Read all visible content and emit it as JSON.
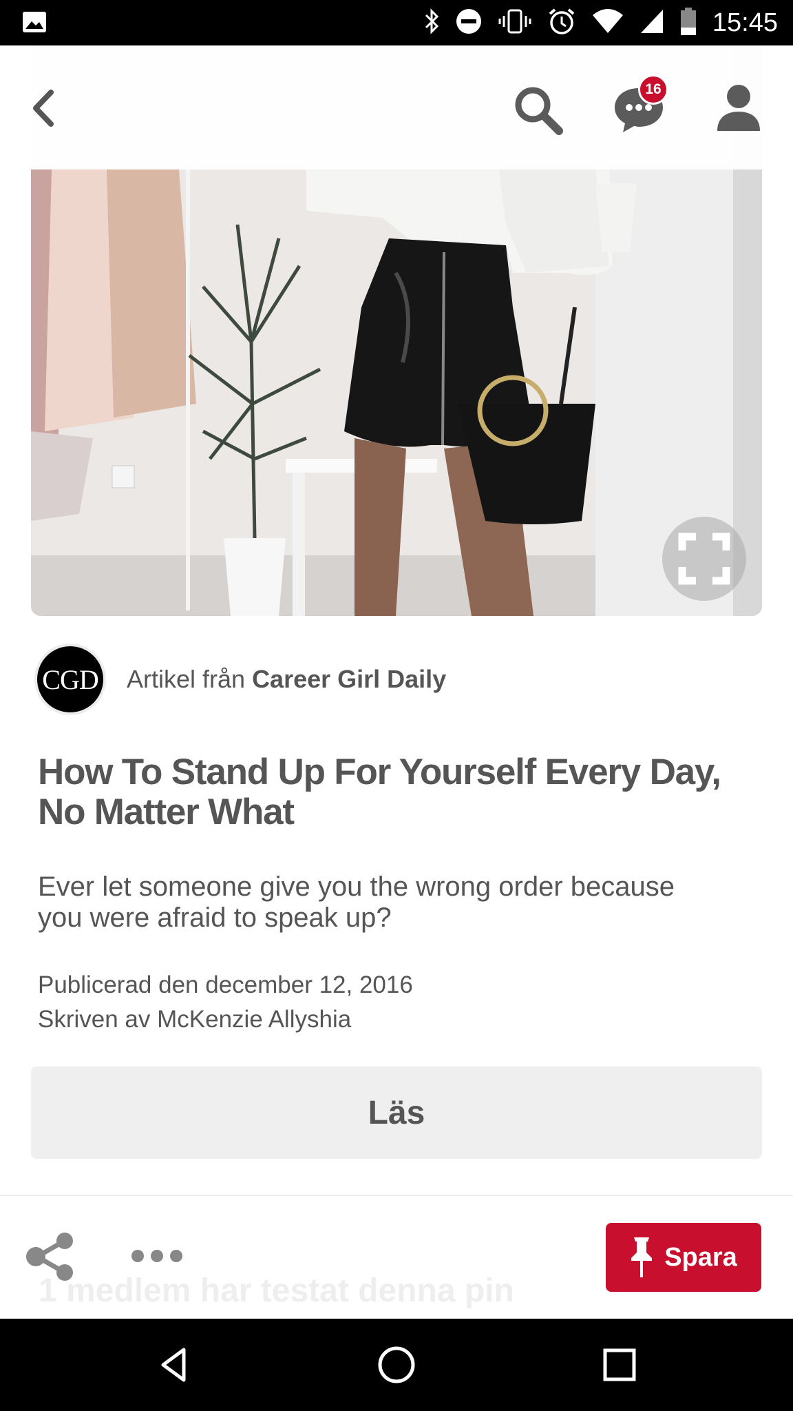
{
  "status_bar": {
    "time": "15:45",
    "icons": [
      "gallery-notification-icon",
      "bluetooth-icon",
      "do-not-disturb-icon",
      "vibrate-icon",
      "alarm-icon",
      "wifi-icon",
      "cellular-signal-icon",
      "battery-icon"
    ]
  },
  "header": {
    "back_icon": "chevron-left-icon",
    "search_icon": "search-icon",
    "messages_icon": "chat-bubble-icon",
    "messages_badge": "16",
    "profile_icon": "person-icon"
  },
  "pin": {
    "image_description_icon": "fashion-photo",
    "expand_icon": "visual-search-icon"
  },
  "source": {
    "avatar_text": "CGD",
    "prefix": "Artikel från ",
    "name": "Career Girl Daily"
  },
  "article": {
    "title": "How To Stand Up For Yourself Every Day, No Matter What",
    "description": "Ever let someone give you the wrong order because you were afraid to speak up?",
    "published": "Publicerad den december 12, 2016",
    "author": "Skriven av McKenzie Allyshia"
  },
  "actions": {
    "read_label": "Läs",
    "save_label": "Spara",
    "faded_text": "1 medlem har testat denna pin",
    "share_icon": "share-icon",
    "more_icon": "more-dots-icon"
  },
  "colors": {
    "brand_red": "#c8102e",
    "text_gray": "#555555",
    "button_gray": "#efefef"
  }
}
